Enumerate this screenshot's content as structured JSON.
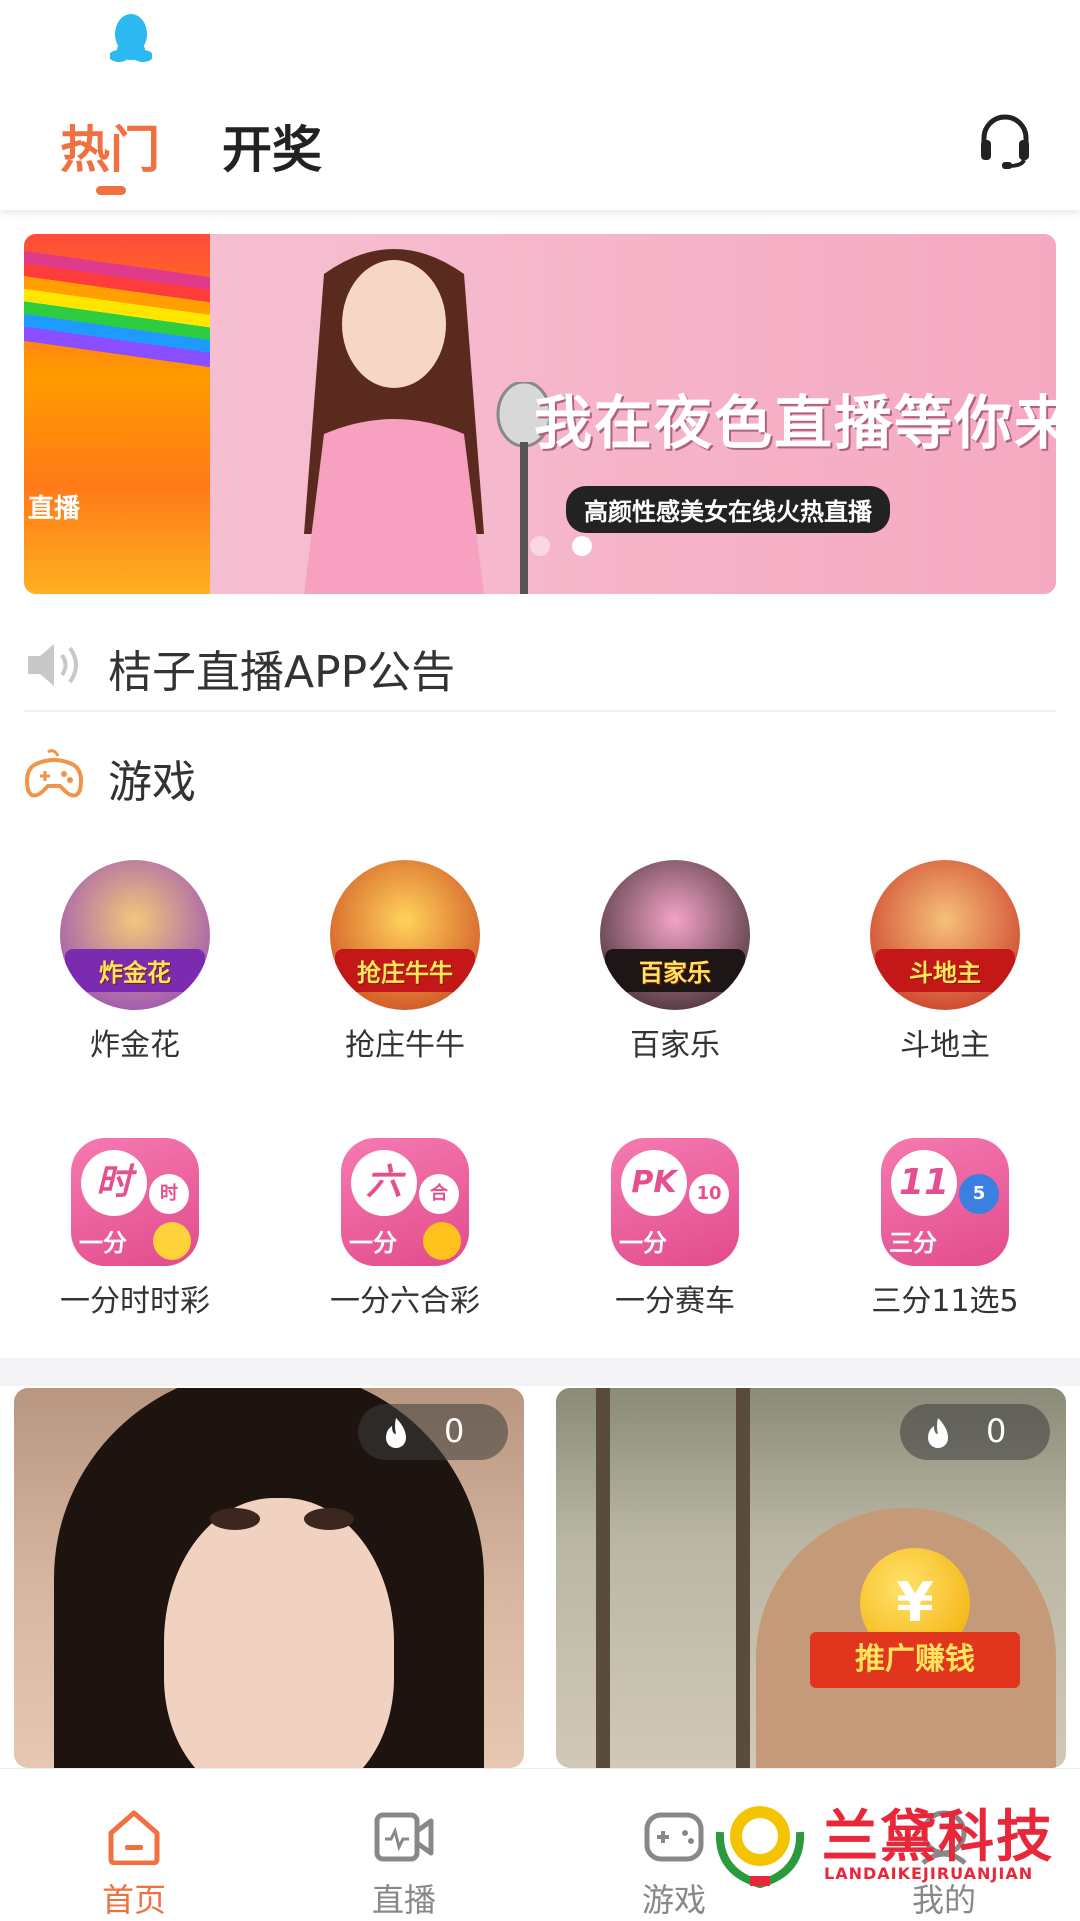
{
  "header": {
    "tabs": [
      {
        "label": "热门",
        "active": true
      },
      {
        "label": "开奖",
        "active": false
      }
    ],
    "support_icon": "headset-icon",
    "accent_color": "#f07040"
  },
  "banner": {
    "title": "我在夜色直播等你来",
    "subtitle": "高颜性感美女在线火热直播",
    "left_text": "直播",
    "dots": 2,
    "active_dot": 1
  },
  "notice": {
    "icon": "speaker-icon",
    "text": "桔子直播APP公告"
  },
  "games_section": {
    "icon": "gamepad-icon",
    "title": "游戏",
    "card_games": [
      {
        "label": "炸金花",
        "badge": "炸金花"
      },
      {
        "label": "抢庄牛牛",
        "badge": "抢庄牛牛"
      },
      {
        "label": "百家乐",
        "badge": "百家乐"
      },
      {
        "label": "斗地主",
        "badge": "斗地主"
      }
    ],
    "lottery_games": [
      {
        "label": "一分时时彩",
        "ball": "时",
        "small": "时",
        "tag": "一分"
      },
      {
        "label": "一分六合彩",
        "ball": "六",
        "small": "合",
        "tag": "一分"
      },
      {
        "label": "一分赛车",
        "ball": "PK",
        "small": "10",
        "tag": "一分"
      },
      {
        "label": "三分11选5",
        "ball": "11",
        "small": "5",
        "tag": "三分"
      }
    ]
  },
  "live_cards": [
    {
      "heat": "0",
      "heat_icon": "flame-icon"
    },
    {
      "heat": "0",
      "heat_icon": "flame-icon"
    }
  ],
  "promo": {
    "coin": "¥",
    "label": "推广赚钱"
  },
  "bottom_nav": [
    {
      "label": "首页",
      "icon": "home-icon",
      "active": true
    },
    {
      "label": "直播",
      "icon": "video-icon",
      "active": false
    },
    {
      "label": "游戏",
      "icon": "gamepad-icon",
      "active": false
    },
    {
      "label": "我的",
      "icon": "user-icon",
      "active": false
    }
  ],
  "watermark": {
    "text": "兰黛科技",
    "subtext": "LANDAIKEJIRUANJIAN"
  }
}
